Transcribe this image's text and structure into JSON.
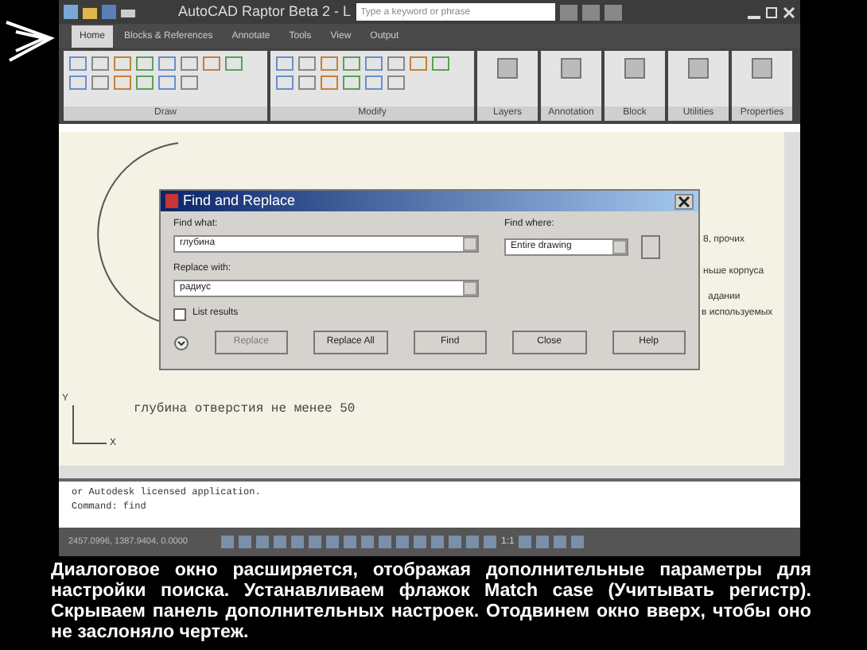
{
  "window": {
    "title": "AutoCAD Raptor Beta 2 - L",
    "search_placeholder": "Type a keyword or phrase"
  },
  "ribbon": {
    "tabs": [
      {
        "label": "Home",
        "selected": true
      },
      {
        "label": "Blocks & References",
        "selected": false
      },
      {
        "label": "Annotate",
        "selected": false
      },
      {
        "label": "Tools",
        "selected": false
      },
      {
        "label": "View",
        "selected": false
      },
      {
        "label": "Output",
        "selected": false
      }
    ],
    "panels": [
      {
        "label": "Draw",
        "kind": "tools"
      },
      {
        "label": "Modify",
        "kind": "tools"
      },
      {
        "label": "Layers",
        "kind": "big"
      },
      {
        "label": "Annotation",
        "kind": "big"
      },
      {
        "label": "Block",
        "kind": "big"
      },
      {
        "label": "Utilities",
        "kind": "big"
      },
      {
        "label": "Properties",
        "kind": "big"
      }
    ]
  },
  "drawing": {
    "axis_labels": [
      "Y",
      "X"
    ],
    "partial_texts": [
      "8, прочих",
      "ньше корпуса",
      "адании",
      "в используемых"
    ],
    "note": "глубина отверстия не менее 50"
  },
  "dialog": {
    "title": "Find and Replace",
    "find_what_label": "Find what:",
    "find_what": "глубина",
    "find_where_label": "Find where:",
    "find_where": "Entire drawing",
    "replace_with_label": "Replace with:",
    "replace_with": "радиус",
    "list_results": {
      "label": "List results",
      "checked": false
    },
    "buttons": [
      {
        "label": "Replace",
        "disabled": true
      },
      {
        "label": "Replace All",
        "disabled": false
      },
      {
        "label": "Find",
        "disabled": false
      },
      {
        "label": "Close",
        "disabled": false
      },
      {
        "label": "Help",
        "disabled": false
      }
    ]
  },
  "command_line": {
    "lines": [
      "or Autodesk licensed application.",
      "Command: find"
    ]
  },
  "status_bar": {
    "coordinates": "2457.0996, 1387.9404, 0.0000",
    "scale": "1:1"
  },
  "caption": "Диалоговое окно расширяется, отображая дополнительные параметры для настройки поиска. Устанавливаем флажок Match case (Учитывать регистр). Скрываем панель дополнительных настроек. Отодвинем окно вверх, чтобы оно не заслоняло чертеж."
}
